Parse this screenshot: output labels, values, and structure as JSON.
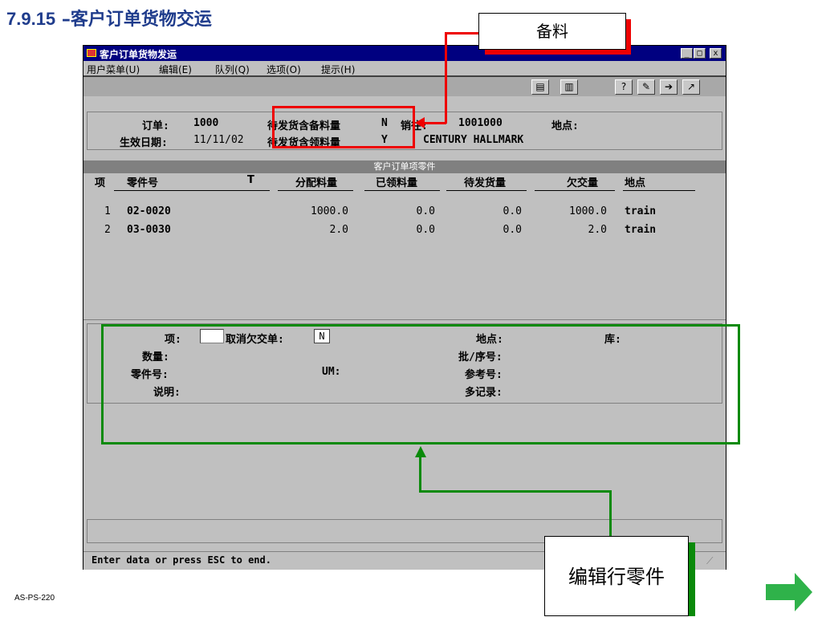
{
  "slide": {
    "title_num": "7.9.15",
    "title_text": "–客户订单货物交运",
    "code": "AS-PS-220"
  },
  "window": {
    "title": "客户订单货物发运",
    "controls": [
      "_",
      "□",
      "x"
    ],
    "menu": [
      "用户菜单(U)",
      "编辑(E)",
      "队列(Q)",
      "选项(O)",
      "提示(H)"
    ],
    "toolbar_icons": [
      "copy-icon",
      "paste-icon",
      "help-icon",
      "edit-help-icon",
      "next-icon",
      "finish-icon"
    ]
  },
  "header": {
    "order_label": "订单:",
    "order_value": "1000",
    "eff_date_label": "生效日期:",
    "eff_date_value": "11/11/02",
    "picked_label": "待发货含备料量",
    "picked_value": "N",
    "issued_label": "待发货含领料量",
    "issued_value": "Y",
    "sold_to_label": "销往:",
    "sold_to_value": "1001000",
    "site_label": "地点:",
    "customer_name": "CENTURY HALLMARK"
  },
  "grid": {
    "title": "客户订单项零件",
    "columns": [
      "项",
      "零件号",
      "T",
      "分配料量",
      "已领料量",
      "待发货量",
      "欠交量",
      "地点"
    ],
    "rows": [
      {
        "item": "1",
        "part": "02-0020",
        "alloc": "1000.0",
        "issued": "0.0",
        "pending": "0.0",
        "backorder": "1000.0",
        "site": "train"
      },
      {
        "item": "2",
        "part": "03-0030",
        "alloc": "2.0",
        "issued": "0.0",
        "pending": "0.0",
        "backorder": "2.0",
        "site": "train"
      }
    ]
  },
  "edit": {
    "line_label": "项:",
    "line_value": "",
    "cancel_bo_label": "取消欠交单:",
    "cancel_bo_value": "N",
    "qty_label": "数量:",
    "part_label": "零件号:",
    "desc_label": "说明:",
    "um_label": "UM:",
    "site_label": "地点:",
    "lot_label": "批/序号:",
    "ref_label": "参考号:",
    "multi_label": "多记录:",
    "loc_label": "库:"
  },
  "status": {
    "message": "Enter data or press ESC to end."
  },
  "callouts": {
    "picking": "备料",
    "edit_line": "编辑行零件"
  },
  "colors": {
    "callout_red": "#ee0000",
    "callout_green": "#0a8a0a",
    "title_blue": "#1f3c8c",
    "titlebar": "#000080"
  }
}
